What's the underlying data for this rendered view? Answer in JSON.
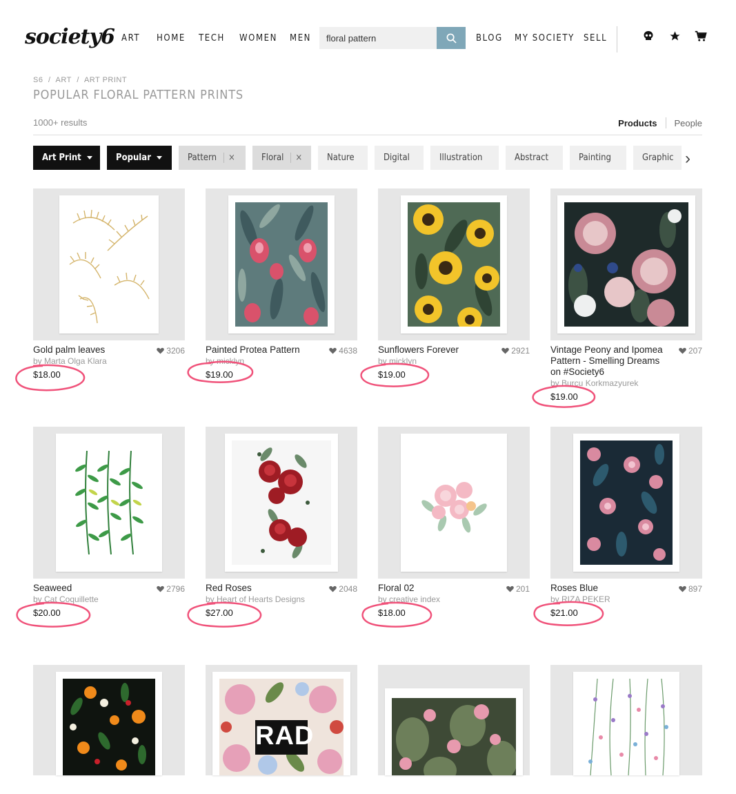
{
  "header": {
    "logo": "society6",
    "nav_left": [
      "ART",
      "HOME",
      "TECH",
      "WOMEN",
      "MEN"
    ],
    "search_value": "floral pattern",
    "nav_right": [
      "BLOG",
      "MY SOCIETY",
      "SELL"
    ],
    "icons": [
      "skull-icon",
      "star-icon",
      "cart-icon"
    ]
  },
  "breadcrumb": [
    "S6",
    "/",
    "ART",
    "/",
    "ART PRINT"
  ],
  "page_title": "POPULAR FLORAL PATTERN PRINTS",
  "results_count": "1000+ results",
  "view_toggle": {
    "products": "Products",
    "people": "People"
  },
  "filters": [
    {
      "label": "Art Print",
      "style": "dark",
      "dropdown": true
    },
    {
      "label": "Popular",
      "style": "dark",
      "dropdown": true
    },
    {
      "label": "Pattern",
      "style": "selected",
      "removable": true
    },
    {
      "label": "Floral",
      "style": "selected",
      "removable": true
    },
    {
      "label": "Nature",
      "style": "plain"
    },
    {
      "label": "Digital",
      "style": "plain"
    },
    {
      "label": "Illustration",
      "style": "plain"
    },
    {
      "label": "Abstract",
      "style": "plain"
    },
    {
      "label": "Painting",
      "style": "plain"
    },
    {
      "label": "Graphic",
      "style": "plain"
    }
  ],
  "remove_glyph": "×",
  "next_glyph": "›",
  "products": [
    {
      "name": "Gold palm leaves",
      "artist": "by Marta Olga Klara",
      "price": "$18.00",
      "likes": "3206"
    },
    {
      "name": "Painted Protea Pattern",
      "artist": "by micklyn",
      "price": "$19.00",
      "likes": "4638"
    },
    {
      "name": "Sunflowers Forever",
      "artist": "by micklyn",
      "price": "$19.00",
      "likes": "2921"
    },
    {
      "name": "Vintage Peony and Ipomea Pattern - Smelling Dreams on #Society6",
      "artist": "by Burcu Korkmazyurek",
      "price": "$19.00",
      "likes": "207"
    },
    {
      "name": "Seaweed",
      "artist": "by Cat Coquillette",
      "price": "$20.00",
      "likes": "2796"
    },
    {
      "name": "Red Roses",
      "artist": "by Heart of Hearts Designs",
      "price": "$27.00",
      "likes": "2048"
    },
    {
      "name": "Floral 02",
      "artist": "by creative index",
      "price": "$18.00",
      "likes": "201"
    },
    {
      "name": "Roses Blue",
      "artist": "by RIZA PEKER",
      "price": "$21.00",
      "likes": "897"
    },
    {
      "name": "",
      "artist": "",
      "price": "",
      "likes": ""
    },
    {
      "name": "",
      "artist": "",
      "price": "",
      "likes": ""
    },
    {
      "name": "",
      "artist": "",
      "price": "",
      "likes": ""
    },
    {
      "name": "",
      "artist": "",
      "price": "",
      "likes": ""
    }
  ],
  "rad_text": "RAD",
  "colors": {
    "search_button": "#7fa7b8",
    "annotation_circle": "#f0527a",
    "dark_chip": "#111111"
  }
}
